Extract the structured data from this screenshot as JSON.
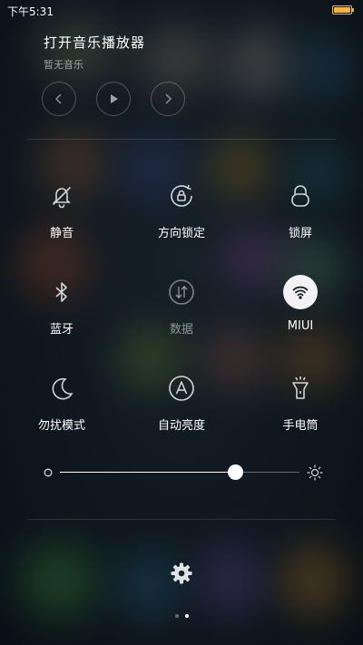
{
  "status_bar": {
    "time": "下午5:31",
    "battery_color": "#f0b53d"
  },
  "music": {
    "title": "打开音乐播放器",
    "subtitle": "暂无音乐",
    "controls": [
      "previous-icon",
      "play-icon",
      "next-icon"
    ]
  },
  "toggles": [
    {
      "label": "静音",
      "icon": "bell-off-icon",
      "state": "off"
    },
    {
      "label": "方向锁定",
      "icon": "rotation-lock-icon",
      "state": "off"
    },
    {
      "label": "锁屏",
      "icon": "lock-icon",
      "state": "off"
    },
    {
      "label": "蓝牙",
      "icon": "bluetooth-icon",
      "state": "off"
    },
    {
      "label": "数据",
      "icon": "mobile-data-icon",
      "state": "disabled"
    },
    {
      "label": "MIUI",
      "icon": "wifi-icon",
      "state": "on"
    },
    {
      "label": "勿扰模式",
      "icon": "moon-icon",
      "state": "off"
    },
    {
      "label": "自动亮度",
      "icon": "auto-brightness-icon",
      "state": "off"
    },
    {
      "label": "手电筒",
      "icon": "flashlight-icon",
      "state": "off"
    }
  ],
  "brightness": {
    "level": 0.73
  },
  "pager": {
    "pages": 2,
    "current": 2
  },
  "colors": {
    "active_toggle_bg": "#f2f2f2",
    "text": "#ffffff"
  }
}
